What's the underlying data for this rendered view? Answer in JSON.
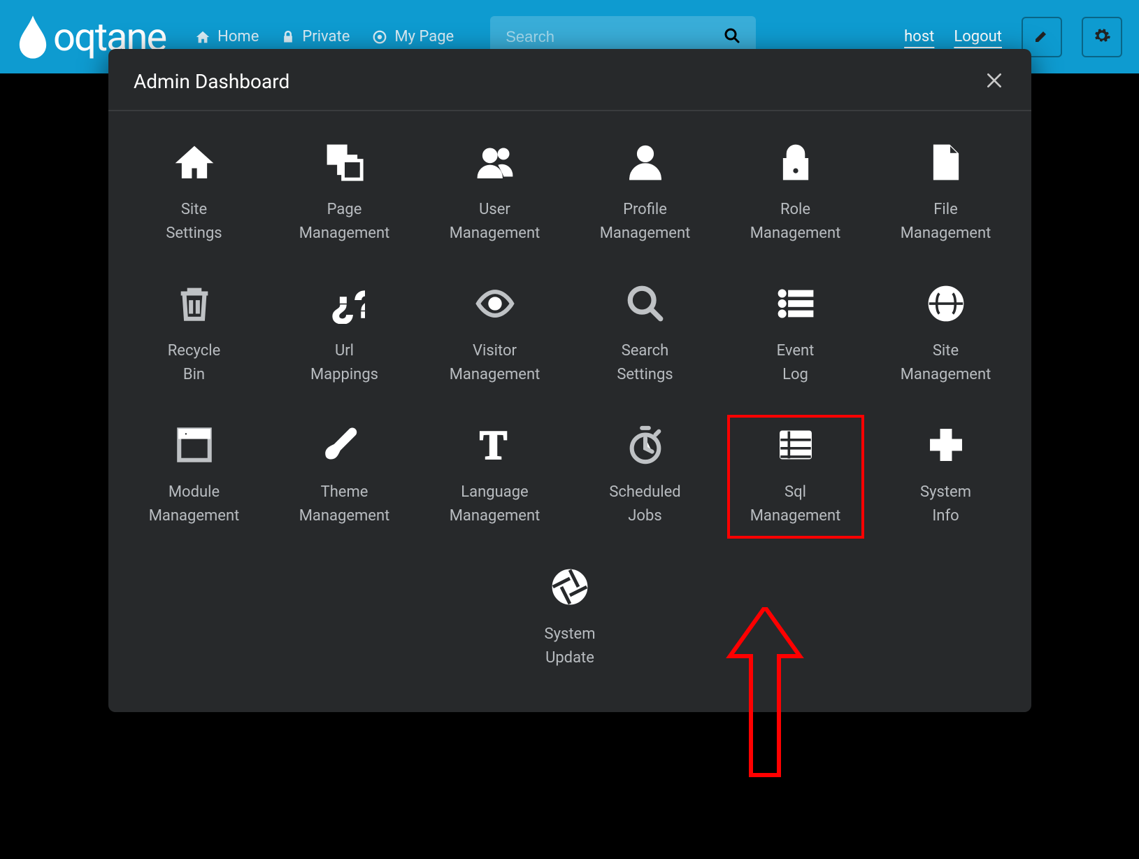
{
  "topbar": {
    "brand": "oqtane",
    "nav": [
      {
        "icon": "home-icon",
        "label": "Home"
      },
      {
        "icon": "lock-icon",
        "label": "Private"
      },
      {
        "icon": "target-icon",
        "label": "My Page"
      }
    ],
    "search_placeholder": "Search",
    "user_label": "host",
    "logout_label": "Logout"
  },
  "modal": {
    "title": "Admin Dashboard",
    "tiles": [
      {
        "name": "site-settings",
        "icon": "home-fill-icon",
        "label": "Site\nSettings"
      },
      {
        "name": "page-management",
        "icon": "pages-icon",
        "label": "Page\nManagement"
      },
      {
        "name": "user-management",
        "icon": "users-icon",
        "label": "User\nManagement"
      },
      {
        "name": "profile-management",
        "icon": "user-icon",
        "label": "Profile\nManagement"
      },
      {
        "name": "role-management",
        "icon": "lock-fill-icon",
        "label": "Role\nManagement"
      },
      {
        "name": "file-management",
        "icon": "file-icon",
        "label": "File\nManagement"
      },
      {
        "name": "recycle-bin",
        "icon": "trash-icon",
        "label": "Recycle\nBin"
      },
      {
        "name": "url-mappings",
        "icon": "question-icon",
        "label": "Url\nMappings"
      },
      {
        "name": "visitor-management",
        "icon": "eye-icon",
        "label": "Visitor\nManagement"
      },
      {
        "name": "search-settings",
        "icon": "search-icon",
        "label": "Search\nSettings"
      },
      {
        "name": "event-log",
        "icon": "list-icon",
        "label": "Event\nLog"
      },
      {
        "name": "site-management",
        "icon": "globe-icon",
        "label": "Site\nManagement"
      },
      {
        "name": "module-management",
        "icon": "module-icon",
        "label": "Module\nManagement"
      },
      {
        "name": "theme-management",
        "icon": "brush-icon",
        "label": "Theme\nManagement"
      },
      {
        "name": "language-management",
        "icon": "type-icon",
        "label": "Language\nManagement"
      },
      {
        "name": "scheduled-jobs",
        "icon": "stopwatch-icon",
        "label": "Scheduled\nJobs"
      },
      {
        "name": "sql-management",
        "icon": "table-icon",
        "label": "Sql\nManagement",
        "highlighted": true
      },
      {
        "name": "system-info",
        "icon": "plus-icon",
        "label": "System\nInfo"
      },
      {
        "name": "system-update",
        "icon": "aperture-icon",
        "label": "System\nUpdate"
      }
    ]
  }
}
